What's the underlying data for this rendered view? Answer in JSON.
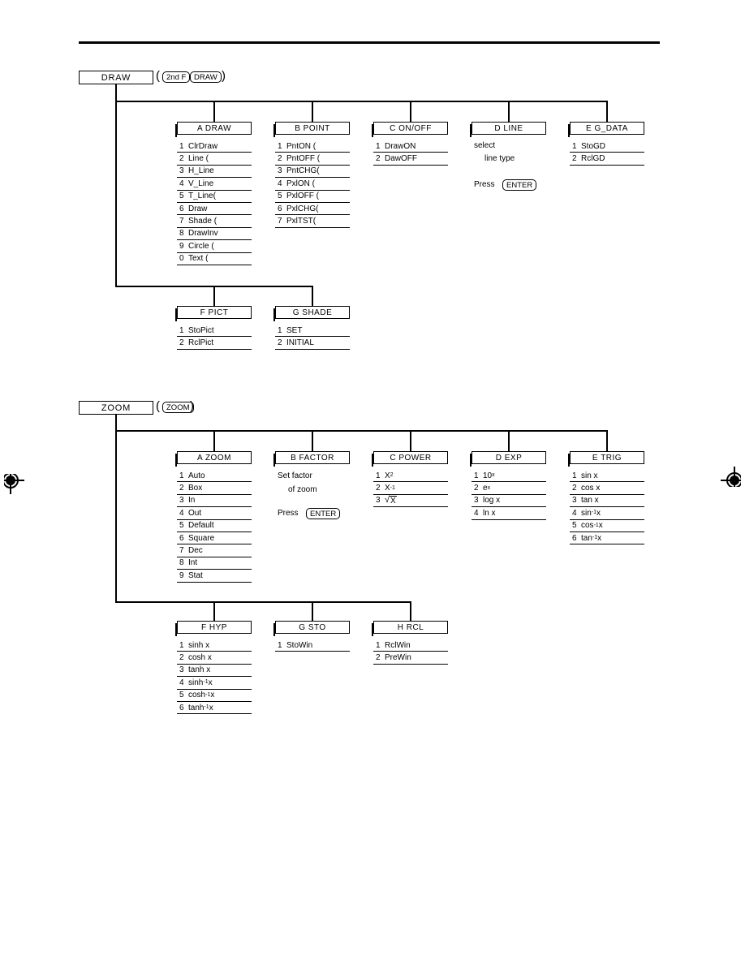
{
  "page": {
    "header_rule": true,
    "registration_marks": 2
  },
  "sections": [
    {
      "id": "draw",
      "root_label": "DRAW",
      "keys": [
        "2nd F",
        "DRAW"
      ],
      "row1": [
        {
          "id": "a-draw",
          "title": "A  DRAW",
          "items": [
            {
              "num": "1",
              "label": "ClrDraw"
            },
            {
              "num": "2",
              "label": "Line ("
            },
            {
              "num": "3",
              "label": "H_Line"
            },
            {
              "num": "4",
              "label": "V_Line"
            },
            {
              "num": "5",
              "label": "T_Line("
            },
            {
              "num": "6",
              "label": "Draw"
            },
            {
              "num": "7",
              "label": "Shade ("
            },
            {
              "num": "8",
              "label": "DrawInv"
            },
            {
              "num": "9",
              "label": "Circle ("
            },
            {
              "num": "0",
              "label": "Text ("
            }
          ]
        },
        {
          "id": "b-point",
          "title": "B  POINT",
          "items": [
            {
              "num": "1",
              "label": "PntON ("
            },
            {
              "num": "2",
              "label": "PntOFF ("
            },
            {
              "num": "3",
              "label": "PntCHG("
            },
            {
              "num": "4",
              "label": "PxlON ("
            },
            {
              "num": "5",
              "label": "PxlOFF ("
            },
            {
              "num": "6",
              "label": "PxlCHG("
            },
            {
              "num": "7",
              "label": "PxlTST("
            }
          ]
        },
        {
          "id": "c-onoff",
          "title": "C  ON/OFF",
          "items": [
            {
              "num": "1",
              "label": "DrawON"
            },
            {
              "num": "2",
              "label": "DawOFF"
            }
          ]
        },
        {
          "id": "d-line",
          "title": "D  LINE",
          "items": [],
          "notes": [
            "select",
            "line type"
          ],
          "press_label": "Press",
          "press_key": "ENTER"
        },
        {
          "id": "e-gdata",
          "title": "E  G_DATA",
          "items": [
            {
              "num": "1",
              "label": "StoGD"
            },
            {
              "num": "2",
              "label": "RclGD"
            }
          ]
        }
      ],
      "row2": [
        {
          "id": "f-pict",
          "title": "F  PICT",
          "items": [
            {
              "num": "1",
              "label": "StoPict"
            },
            {
              "num": "2",
              "label": "RclPict"
            }
          ]
        },
        {
          "id": "g-shade",
          "title": "G  SHADE",
          "items": [
            {
              "num": "1",
              "label": "SET"
            },
            {
              "num": "2",
              "label": "INITIAL"
            }
          ]
        }
      ]
    },
    {
      "id": "zoom",
      "root_label": "ZOOM",
      "keys": [
        "ZOOM"
      ],
      "row1": [
        {
          "id": "a-zoom",
          "title": "A  ZOOM",
          "items": [
            {
              "num": "1",
              "label": "Auto"
            },
            {
              "num": "2",
              "label": "Box"
            },
            {
              "num": "3",
              "label": "In"
            },
            {
              "num": "4",
              "label": "Out"
            },
            {
              "num": "5",
              "label": "Default"
            },
            {
              "num": "6",
              "label": "Square"
            },
            {
              "num": "7",
              "label": "Dec"
            },
            {
              "num": "8",
              "label": "Int"
            },
            {
              "num": "9",
              "label": "Stat"
            }
          ]
        },
        {
          "id": "b-factor",
          "title": "B  FACTOR",
          "items": [],
          "notes": [
            "Set factor",
            "of zoom"
          ],
          "press_label": "Press",
          "press_key": "ENTER"
        },
        {
          "id": "c-power",
          "title": "C  POWER",
          "items": [
            {
              "num": "1",
              "label": "X",
              "sup": "2"
            },
            {
              "num": "2",
              "label": "X",
              "sup": "-1"
            },
            {
              "num": "3",
              "label": "X",
              "radical": true
            }
          ]
        },
        {
          "id": "d-exp",
          "title": "D  EXP",
          "items": [
            {
              "num": "1",
              "label": "10",
              "sup": "x"
            },
            {
              "num": "2",
              "label": "e",
              "sup": "x"
            },
            {
              "num": "3",
              "label": "log x"
            },
            {
              "num": "4",
              "label": "ln x"
            }
          ]
        },
        {
          "id": "e-trig",
          "title": "E  TRIG",
          "items": [
            {
              "num": "1",
              "label": "sin x"
            },
            {
              "num": "2",
              "label": "cos x"
            },
            {
              "num": "3",
              "label": "tan x"
            },
            {
              "num": "4",
              "label": "sin",
              "sup": "-1",
              "tail": " x"
            },
            {
              "num": "5",
              "label": "cos",
              "sup": "-1",
              "tail": " x"
            },
            {
              "num": "6",
              "label": "tan",
              "sup": "-1",
              "tail": " x"
            }
          ]
        }
      ],
      "row2": [
        {
          "id": "f-hyp",
          "title": "F  HYP",
          "items": [
            {
              "num": "1",
              "label": "sinh x"
            },
            {
              "num": "2",
              "label": "cosh x"
            },
            {
              "num": "3",
              "label": "tanh x"
            },
            {
              "num": "4",
              "label": "sinh",
              "sup": "-1",
              "tail": "x"
            },
            {
              "num": "5",
              "label": "cosh",
              "sup": "-1",
              "tail": "x"
            },
            {
              "num": "6",
              "label": "tanh",
              "sup": "-1",
              "tail": "x"
            }
          ]
        },
        {
          "id": "g-sto",
          "title": "G  STO",
          "items": [
            {
              "num": "1",
              "label": "StoWin"
            }
          ]
        },
        {
          "id": "h-rcl",
          "title": "H  RCL",
          "items": [
            {
              "num": "1",
              "label": "RclWin"
            },
            {
              "num": "2",
              "label": "PreWin"
            }
          ]
        }
      ]
    }
  ]
}
